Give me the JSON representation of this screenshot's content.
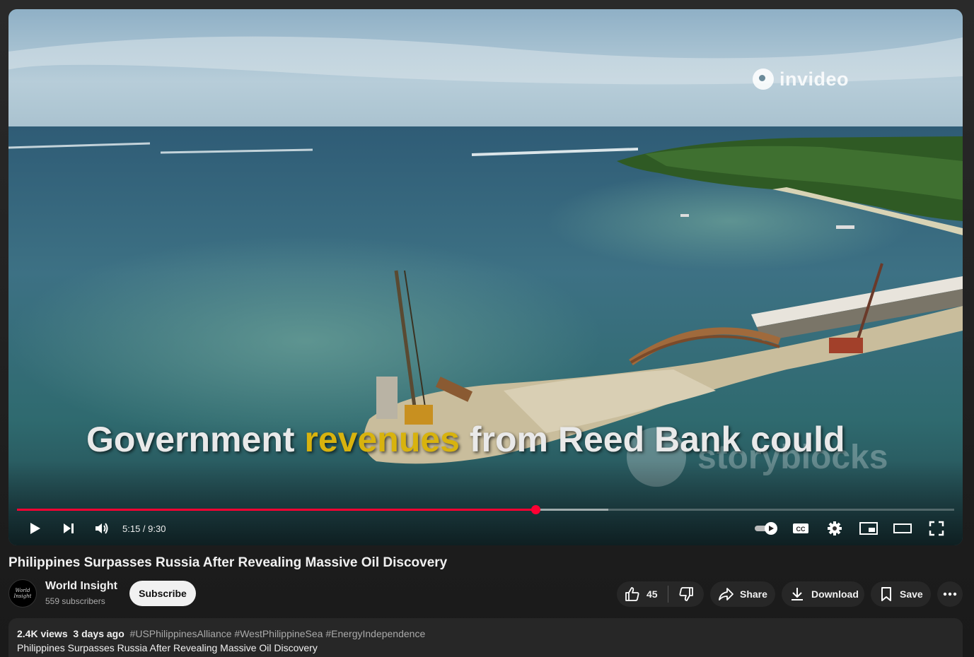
{
  "player": {
    "caption_before": "Government ",
    "caption_highlight": "revenues",
    "caption_after": " from Reed Bank could",
    "watermark_top": "invideo",
    "watermark_bottom": "storyblocks",
    "time_display": "5:15 / 9:30",
    "progress_played_fraction": 0.553,
    "progress_buffered_fraction": 0.631,
    "colors": {
      "progress": "#ff0033"
    },
    "icons": [
      "play-icon",
      "next-icon",
      "volume-icon",
      "autoplay-toggle-icon",
      "cc-icon",
      "settings-icon",
      "miniplayer-icon",
      "theater-icon",
      "fullscreen-icon"
    ]
  },
  "video": {
    "title": "Philippines Surpasses Russia After Revealing Massive Oil Discovery"
  },
  "channel": {
    "name": "World Insight",
    "subscribers": "559 subscribers",
    "subscribe_label": "Subscribe",
    "avatar_text": "World Insight"
  },
  "actions": {
    "like_count": "45",
    "share_label": "Share",
    "download_label": "Download",
    "save_label": "Save"
  },
  "description": {
    "views": "2.4K views",
    "age": "3 days ago",
    "hashtags": "#USPhilippinesAlliance #WestPhilippineSea #EnergyIndependence",
    "text": "Philippines Surpasses Russia After Revealing Massive Oil Discovery"
  }
}
